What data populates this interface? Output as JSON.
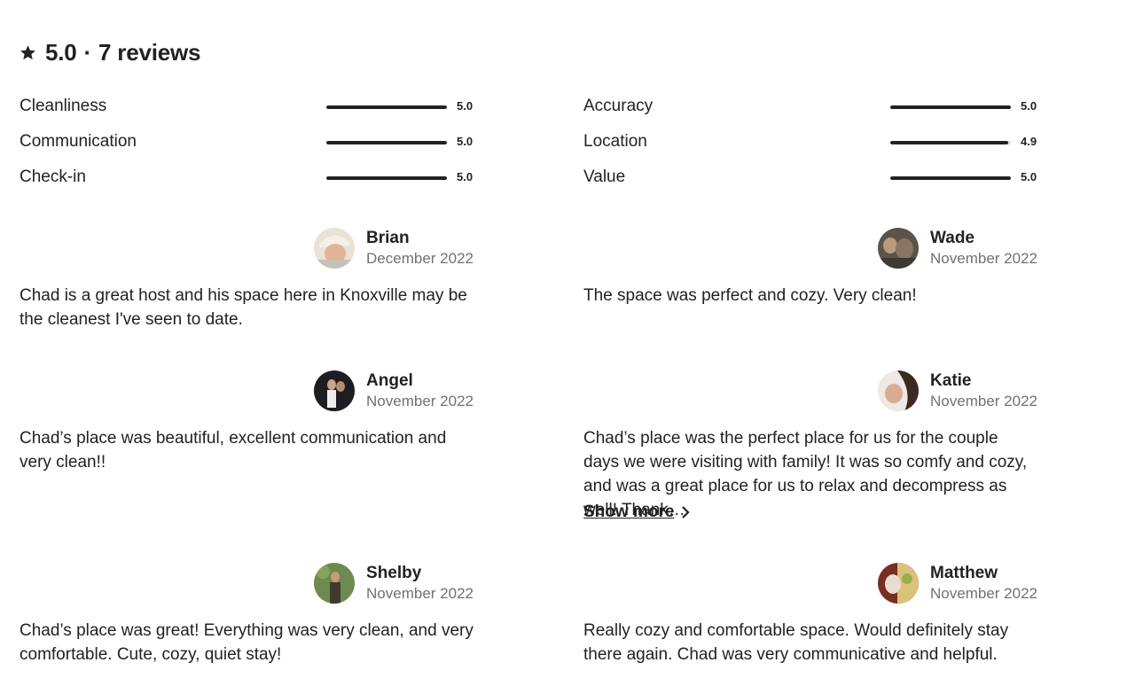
{
  "summary": {
    "rating": "5.0",
    "separator": "·",
    "reviews_label": "7 reviews"
  },
  "categories": [
    {
      "label": "Cleanliness",
      "value": "5.0",
      "score": 5.0
    },
    {
      "label": "Communication",
      "value": "5.0",
      "score": 5.0
    },
    {
      "label": "Check-in",
      "value": "5.0",
      "score": 5.0
    },
    {
      "label": "Accuracy",
      "value": "5.0",
      "score": 5.0
    },
    {
      "label": "Location",
      "value": "4.9",
      "score": 4.9
    },
    {
      "label": "Value",
      "value": "5.0",
      "score": 5.0
    }
  ],
  "reviews": [
    {
      "name": "Brian",
      "date": "December 2022",
      "text": "Chad is a great host and his space here in Knoxville may be the cleanest I've seen to date."
    },
    {
      "name": "Wade",
      "date": "November 2022",
      "text": "The space was perfect and cozy. Very clean!"
    },
    {
      "name": "Angel",
      "date": "November 2022",
      "text": "Chad’s place was beautiful, excellent communication and very clean!!"
    },
    {
      "name": "Katie",
      "date": "November 2022",
      "text": "Chad’s place was the perfect place for us for the couple days we were visiting with family! It was so comfy and cozy, and was a great place for us to relax and decompress as well! Thank…",
      "show_more": "Show more"
    },
    {
      "name": "Shelby",
      "date": "November 2022",
      "text": "Chad’s place was great! Everything was very clean, and very comfortable. Cute, cozy, quiet stay!"
    },
    {
      "name": "Matthew",
      "date": "November 2022",
      "text": "Really cozy and comfortable space. Would definitely stay there again. Chad was very communicative and helpful."
    }
  ],
  "colors": {
    "text": "#222222",
    "muted": "#717171",
    "bar_track": "#dddddd",
    "bar_fill": "#222222"
  }
}
